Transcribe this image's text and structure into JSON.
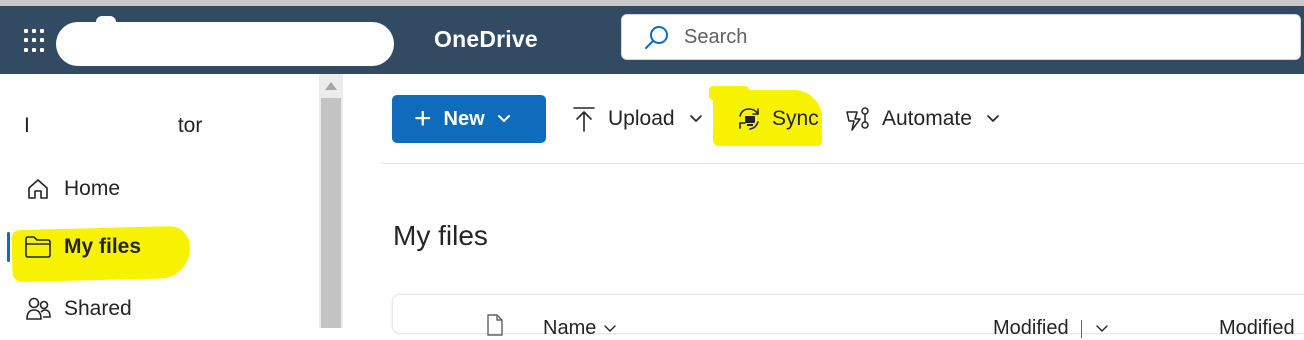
{
  "suitebar": {
    "app_name": "OneDrive",
    "search_placeholder": "Search",
    "icons": [
      "waffle-icon",
      "search-icon"
    ]
  },
  "sidebar": {
    "user_prefix": "I",
    "user_suffix": "tor",
    "items": [
      {
        "label": "Home",
        "icon": "home-icon"
      },
      {
        "label": "My files",
        "icon": "folder-icon",
        "active": true
      },
      {
        "label": "Shared",
        "icon": "people-icon"
      }
    ]
  },
  "commandbar": {
    "new_label": "New",
    "upload_label": "Upload",
    "sync_label": "Sync",
    "automate_label": "Automate"
  },
  "main": {
    "title": "My files",
    "columns": [
      "Name",
      "Modified",
      "Modified"
    ]
  },
  "colors": {
    "suitebar_bg": "#334a63",
    "primary": "#0f6cbd",
    "highlight": "#f7f300"
  }
}
